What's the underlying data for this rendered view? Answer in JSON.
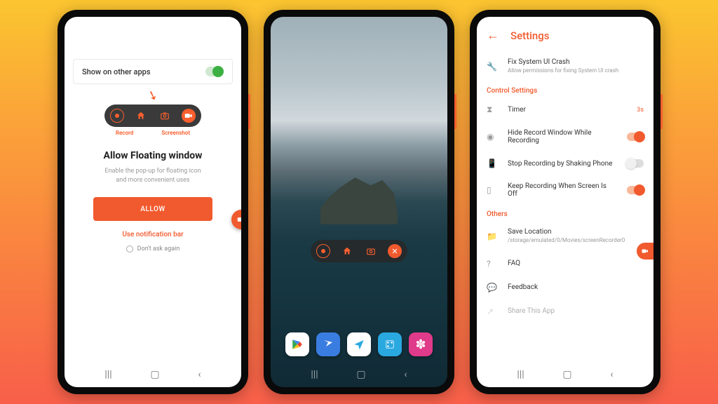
{
  "phone1": {
    "show_on_apps": "Show on other apps",
    "pill_labels": {
      "record": "Record",
      "screenshot": "Screenshot"
    },
    "title": "Allow Floating window",
    "desc": "Enable the pop-up for floating icon and more convenient uses",
    "allow_btn": "ALLOW",
    "link": "Use notification bar",
    "dont_ask": "Don't ask again"
  },
  "phone3": {
    "header_title": "Settings",
    "fix_crash": {
      "title": "Fix System UI Crash",
      "sub": "Allow permissions for fixing System UI crash"
    },
    "sect_control": "Control Settings",
    "timer": {
      "label": "Timer",
      "value": "3s"
    },
    "hide_window": "Hide Record Window While Recording",
    "shake": "Stop Recording by Shaking Phone",
    "keep_off": "Keep Recording When Screen Is Off",
    "sect_others": "Others",
    "save_loc": {
      "title": "Save Location",
      "sub": "/storage/emulated/0/Movies/screenRecorder0"
    },
    "faq": "FAQ",
    "feedback": "Feedback",
    "share": "Share This App"
  }
}
